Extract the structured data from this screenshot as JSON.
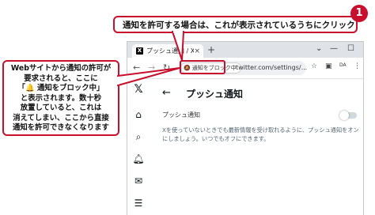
{
  "callouts": {
    "top": "通知を許可する場合は、これが表示されているうちにクリック",
    "step_number": "1",
    "left_lines": [
      "Webサイトから通知の許可が",
      "要求されると、ここに",
      "「🔔 通知をブロック中」",
      "と表示されます。数十秒",
      "放置していると、これは",
      "消えてしまい、ここから直接",
      "通知を許可できなくなります"
    ]
  },
  "browser": {
    "tab_title": "プッシュ通知 / X",
    "tab_favicon": "X",
    "tab_close": "×",
    "new_tab": "+",
    "window_controls": [
      "⌄",
      "—",
      "☐"
    ],
    "chip_label": "通知をブロック中",
    "url": "twitter.com/settings/...",
    "profile_badge": "DA"
  },
  "page": {
    "title": "プッシュ通知",
    "setting_label": "プッシュ通知",
    "setting_desc": "Xを使っていないときでも最新情報を受け取れるように、プッシュ通知をオンにしましょう。いつでもオフにできます。"
  },
  "colors": {
    "callout_border": "#c8102e",
    "toggle_track": "#cfd9de",
    "muted_text": "#536471"
  },
  "icons": [
    "back-arrow-icon",
    "forward-arrow-icon",
    "reload-icon",
    "bell-slash-icon",
    "star-icon",
    "extension-icon",
    "sidepanel-icon",
    "menu-icon",
    "x-logo-icon",
    "home-icon",
    "search-icon",
    "notifications-icon",
    "messages-icon",
    "lists-icon"
  ]
}
